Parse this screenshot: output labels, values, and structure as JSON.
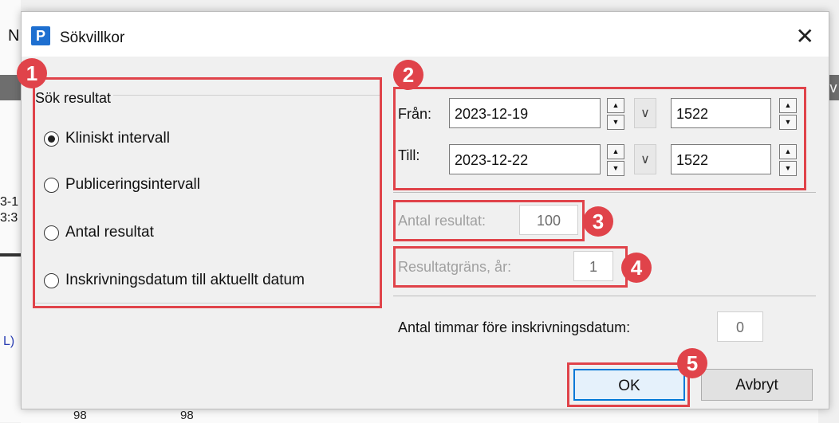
{
  "background": {
    "letter_n": "N",
    "left_fragment_1": "3-1",
    "left_fragment_2": "3:3",
    "left_fragment_3": "L)",
    "right_fragment": "v",
    "bottom_1": "98",
    "bottom_2": "98"
  },
  "dialog": {
    "app_icon_letter": "P",
    "title": "Sökvillkor",
    "close_glyph": "✕"
  },
  "search_group": {
    "label": "Sök resultat",
    "options": [
      {
        "label": "Kliniskt intervall",
        "checked": true
      },
      {
        "label": "Publiceringsintervall",
        "checked": false
      },
      {
        "label": "Antal resultat",
        "checked": false
      },
      {
        "label": "Inskrivningsdatum till aktuellt datum",
        "checked": false
      }
    ]
  },
  "date_range": {
    "from_label": "Från:",
    "from_date": "2023-12-19",
    "from_time": "1522",
    "to_label": "Till:",
    "to_date": "2023-12-22",
    "to_time": "1522"
  },
  "result_count": {
    "label": "Antal resultat:",
    "value": "100"
  },
  "result_limit": {
    "label": "Resultatgräns, år:",
    "value": "1"
  },
  "hours_before": {
    "label": "Antal timmar före inskrivningsdatum:",
    "value": "0"
  },
  "buttons": {
    "ok": "OK",
    "cancel": "Avbryt"
  },
  "badges": [
    "1",
    "2",
    "3",
    "4",
    "5"
  ],
  "icons": {
    "spin_up": "▲",
    "spin_down": "▼",
    "dropdown": "∨"
  },
  "colors": {
    "highlight": "#e0434a",
    "app_icon": "#1e6fd0",
    "default_button_border": "#0078d7"
  }
}
